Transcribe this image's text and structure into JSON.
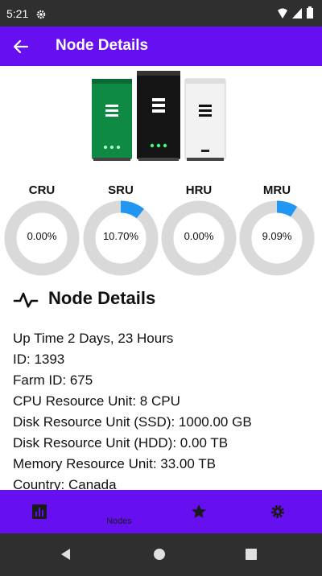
{
  "status_bar": {
    "time": "5:21",
    "icons": [
      "gear-icon",
      "wifi-icon",
      "signal-icon",
      "battery-icon"
    ]
  },
  "app_bar": {
    "title": "Node Details",
    "back_icon": "arrow-left-icon"
  },
  "gauges": [
    {
      "label": "CRU",
      "value_text": "0.00%",
      "percent": 0.0
    },
    {
      "label": "SRU",
      "value_text": "10.70%",
      "percent": 10.7
    },
    {
      "label": "HRU",
      "value_text": "0.00%",
      "percent": 0.0
    },
    {
      "label": "MRU",
      "value_text": "9.09%",
      "percent": 9.09
    }
  ],
  "colors": {
    "accent": "#6610f2",
    "gauge_track": "#d9d9d9",
    "gauge_fill": "#2196f3"
  },
  "section": {
    "title": "Node Details",
    "icon": "activity-icon"
  },
  "details": [
    "Up Time 2 Days, 23 Hours",
    "ID: 1393",
    "Farm ID:  675",
    "CPU Resource Unit:   8 CPU",
    "Disk Resource Unit (SSD): 1000.00 GB",
    "Disk Resource Unit (HDD): 0.00 TB",
    "Memory Resource Unit: 33.00 TB",
    "Country: Canada"
  ],
  "bottom_nav": [
    {
      "icon": "chart-icon",
      "label": ""
    },
    {
      "icon": "",
      "label": "Nodes"
    },
    {
      "icon": "star-icon",
      "label": ""
    },
    {
      "icon": "gear-icon",
      "label": ""
    }
  ]
}
